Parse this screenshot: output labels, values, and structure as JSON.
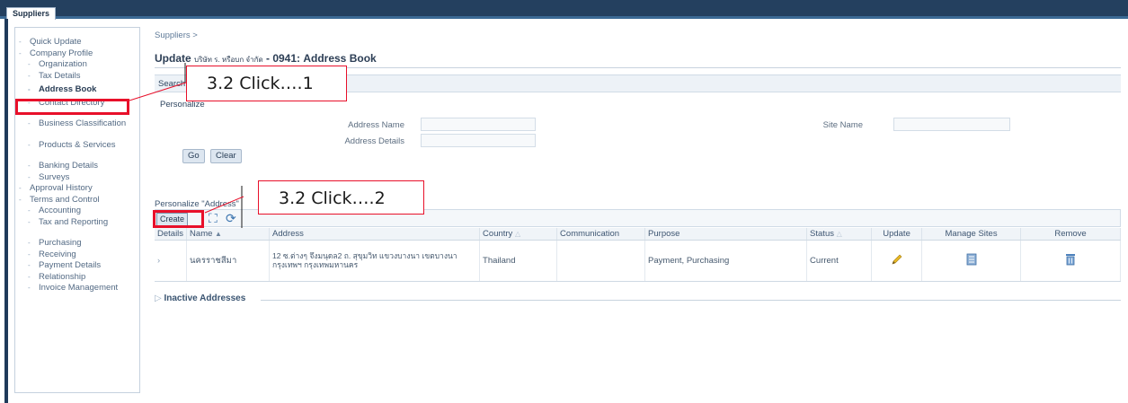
{
  "app": {
    "tab_label": "Suppliers"
  },
  "sidebar": {
    "items": [
      {
        "label": "Quick Update",
        "level": 0
      },
      {
        "label": "Company Profile",
        "level": 0
      },
      {
        "label": "Organization",
        "level": 1
      },
      {
        "label": "Tax Details",
        "level": 1
      },
      {
        "label": "Address Book",
        "level": 1,
        "selected": true
      },
      {
        "label": "Contact Directory",
        "level": 1
      },
      {
        "label": "Business Classification",
        "level": 1
      },
      {
        "label": "Products & Services",
        "level": 1
      },
      {
        "label": "Banking Details",
        "level": 1
      },
      {
        "label": "Surveys",
        "level": 1
      },
      {
        "label": "Approval History",
        "level": 0
      },
      {
        "label": "Terms and Control",
        "level": 0
      },
      {
        "label": "Accounting",
        "level": 1
      },
      {
        "label": "Tax and Reporting",
        "level": 1
      },
      {
        "label": "Purchasing",
        "level": 1
      },
      {
        "label": "Receiving",
        "level": 1
      },
      {
        "label": "Payment Details",
        "level": 1
      },
      {
        "label": "Relationship",
        "level": 1
      },
      {
        "label": "Invoice Management",
        "level": 1
      }
    ]
  },
  "page": {
    "breadcrumb": "Suppliers >",
    "title_prefix": "Update",
    "title_small": "บริษัท ร. หรือบก จำกัด",
    "title_suffix": "- 0941: Address Book"
  },
  "search": {
    "section_label": "Search",
    "personalize_label": "Personalize",
    "address_name_label": "Address Name",
    "address_details_label": "Address Details",
    "site_name_label": "Site Name",
    "go_label": "Go",
    "clear_label": "Clear"
  },
  "results": {
    "personalize_label": "Personalize \"Address\"",
    "create_label": "Create",
    "columns": [
      "Details",
      "Name",
      "Address",
      "Country",
      "Communication",
      "Purpose",
      "Status",
      "Update",
      "Manage Sites",
      "Remove"
    ],
    "rows": [
      {
        "details": "›",
        "name": "นครราชสีมา",
        "address": "12 ซ.ต่างๆ จึงมนุดล2 ถ. สุขุมวิท แขวงบางนา เขตบางนา กรุงเทพฯ กรุงเทพมหานคร",
        "country": "Thailand",
        "communication": "",
        "purpose": "Payment, Purchasing",
        "status": "Current"
      }
    ]
  },
  "inactive": {
    "label": "Inactive Addresses"
  },
  "callouts": {
    "first": "3.2 Click….1",
    "second": "3.2 Click….2"
  },
  "colors": {
    "highlight": "#e8102a",
    "topbar": "#24405f",
    "accent_icon": "#3e76b0"
  }
}
